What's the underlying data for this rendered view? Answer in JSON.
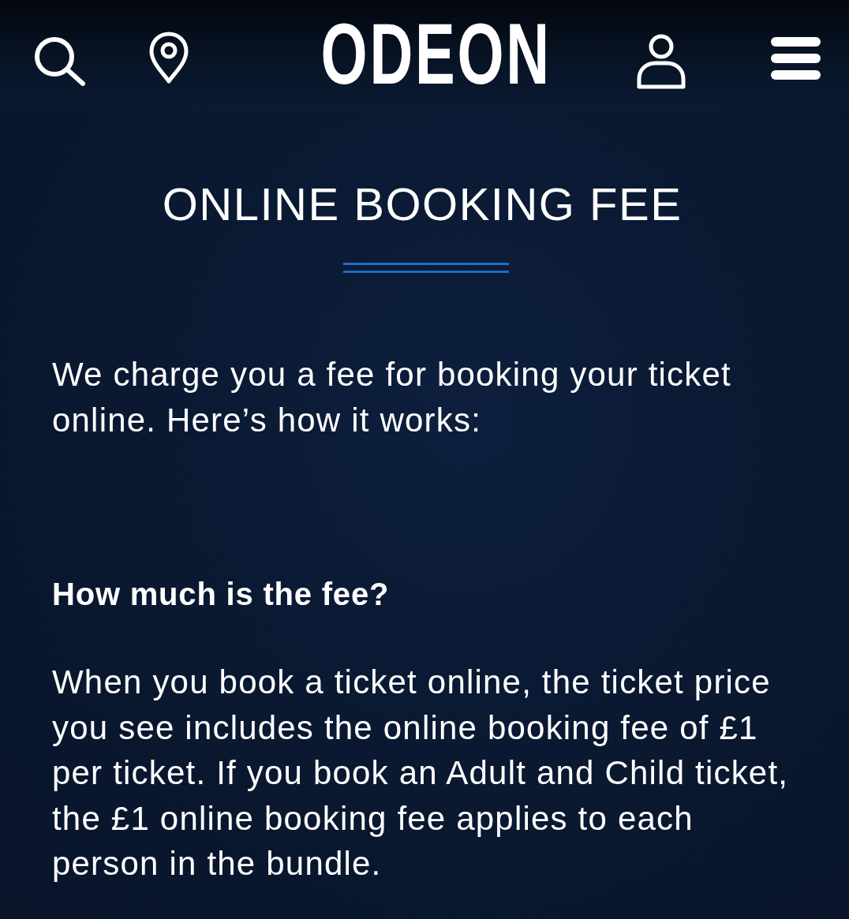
{
  "header": {
    "logo": "ODEON"
  },
  "page": {
    "title": "ONLINE BOOKING FEE",
    "intro": "We charge you a fee for booking your ticket online. Here’s how it works:",
    "sections": [
      {
        "heading": "How much is the fee?",
        "body": "When you book a ticket online, the ticket price you see includes the online booking fee of £1 per ticket. If you book an Adult and Child ticket, the £1 online booking fee applies to each person in the bundle."
      }
    ]
  }
}
